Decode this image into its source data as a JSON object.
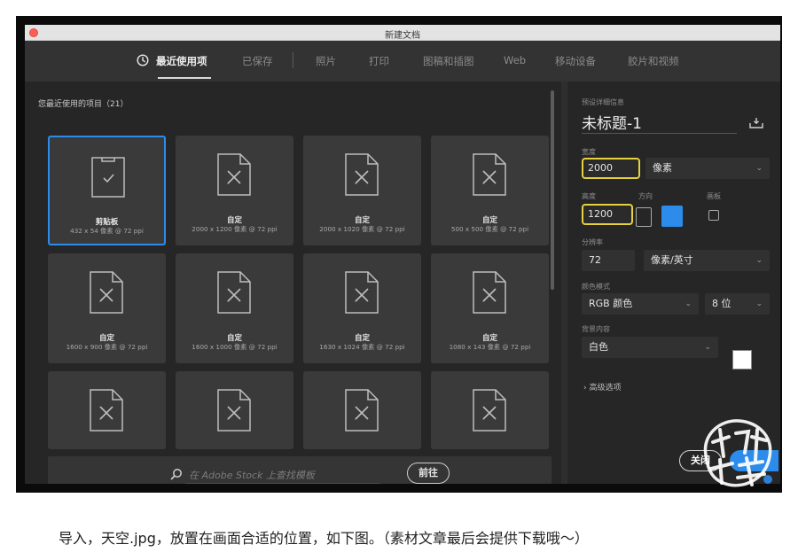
{
  "window": {
    "title": "新建文档"
  },
  "tabs": [
    {
      "label": "最近使用项",
      "active": true
    },
    {
      "label": "已保存"
    },
    {
      "label": "照片"
    },
    {
      "label": "打印"
    },
    {
      "label": "图稿和插图"
    },
    {
      "label": "Web"
    },
    {
      "label": "移动设备"
    },
    {
      "label": "胶片和视频"
    }
  ],
  "recent": {
    "heading": "您最近使用的项目（21）",
    "items": [
      {
        "name": "剪贴板",
        "size": "432 x 54 像素 @ 72 ppi",
        "icon": "clipboard-doc-icon",
        "selected": true
      },
      {
        "name": "自定",
        "size": "2000 x 1200 像素 @ 72 ppi",
        "icon": "custom-doc-icon"
      },
      {
        "name": "自定",
        "size": "2000 x 1020 像素 @ 72 ppi",
        "icon": "custom-doc-icon"
      },
      {
        "name": "自定",
        "size": "500 x 500 像素 @ 72 ppi",
        "icon": "custom-doc-icon"
      },
      {
        "name": "自定",
        "size": "1600 x 900 像素 @ 72 ppi",
        "icon": "custom-doc-icon"
      },
      {
        "name": "自定",
        "size": "1600 x 1000 像素 @ 72 ppi",
        "icon": "custom-doc-icon"
      },
      {
        "name": "自定",
        "size": "1630 x 1024 像素 @ 72 ppi",
        "icon": "custom-doc-icon"
      },
      {
        "name": "自定",
        "size": "1080 x 143 像素 @ 72 ppi",
        "icon": "custom-doc-icon"
      },
      {
        "name": "",
        "size": "",
        "icon": "custom-doc-icon"
      },
      {
        "name": "",
        "size": "",
        "icon": "custom-doc-icon"
      },
      {
        "name": "",
        "size": "",
        "icon": "custom-doc-icon"
      },
      {
        "name": "",
        "size": "",
        "icon": "custom-doc-icon"
      }
    ]
  },
  "search": {
    "placeholder": "在 Adobe Stock 上查找模板",
    "button": "前往"
  },
  "details": {
    "section_label": "预设详细信息",
    "doc_name": "未标题-1",
    "width_label": "宽度",
    "width_value": "2000",
    "width_unit": "像素",
    "height_label": "高度",
    "height_value": "1200",
    "orientation_label": "方向",
    "artboard_label": "画板",
    "resolution_label": "分辨率",
    "resolution_value": "72",
    "resolution_unit": "像素/英寸",
    "color_mode_label": "颜色模式",
    "color_mode": "RGB 颜色",
    "bit_depth": "8 位",
    "background_label": "背景内容",
    "background": "白色",
    "background_color": "#ffffff",
    "advanced": "› 高级选项"
  },
  "buttons": {
    "close": "关闭"
  },
  "watermark": "创意炒饭",
  "caption": "导入，天空.jpg，放置在画面合适的位置，如下图。（素材文章最后会提供下载哦～）",
  "colors": {
    "accent": "#2d8ceb",
    "highlight": "#e5d23d"
  }
}
